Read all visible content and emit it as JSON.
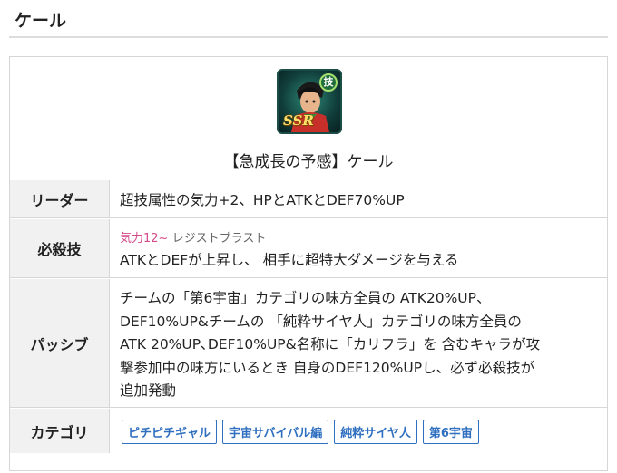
{
  "page": {
    "heading": "ケール"
  },
  "card": {
    "name": "【急成長の予感】ケール",
    "icon": {
      "type_badge": "技",
      "rarity": "SSR",
      "element_color": "#2f8a77"
    },
    "rows": {
      "leader": {
        "label": "リーダー",
        "value": "超技属性の気力+2、HPとATKとDEF70%UP"
      },
      "special": {
        "label": "必殺技",
        "ki_cost": "気力12~",
        "name": "レジストブラスト",
        "value": "ATKとDEFが上昇し、 相手に超特大ダメージを与える"
      },
      "passive": {
        "label": "パッシブ",
        "lines": [
          "チームの「第6宇宙」カテゴリの味方全員の ATK20%UP、",
          "DEF10%UP&チームの 「純粋サイヤ人」カテゴリの味方全員の",
          "ATK 20%UP､DEF10%UP&名称に「カリフラ」を 含むキャラが攻",
          "撃参加中の味方にいるとき 自身のDEF120%UPし、必ず必殺技が",
          "追加発動"
        ]
      },
      "category": {
        "label": "カテゴリ",
        "tags": [
          "ピチピチギャル",
          "宇宙サバイバル編",
          "純粋サイヤ人",
          "第6宇宙"
        ]
      }
    }
  },
  "colors": {
    "tag_blue": "#2f6fc0",
    "ki_pink": "#d44b8a",
    "label_bg": "#f1f1f1"
  }
}
